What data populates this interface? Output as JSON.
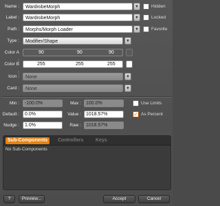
{
  "name": {
    "label": "Name :",
    "value": "WardrobeMorph"
  },
  "label_row": {
    "label": "Label :",
    "value": "WardrobeMorph"
  },
  "path": {
    "label": "Path :",
    "value": "Morphs/Morph Loader"
  },
  "type": {
    "label": "Type :",
    "value": "Modifier/Shape"
  },
  "color_a": {
    "label": "Color A :",
    "r": "90",
    "g": "90",
    "b": "90",
    "swatch": "#5a5a5a"
  },
  "color_b": {
    "label": "Color B :",
    "r": "255",
    "g": "255",
    "b": "255",
    "swatch": "#ffffff"
  },
  "icon": {
    "label": "Icon :",
    "value": "None"
  },
  "card": {
    "label": "Card :",
    "value": "None"
  },
  "checks": {
    "hidden": {
      "label": "Hidden",
      "checked": false
    },
    "locked": {
      "label": "Locked",
      "checked": false
    },
    "favorite": {
      "label": "Favorite",
      "checked": false
    },
    "use_limits": {
      "label": "Use Limits",
      "checked": false
    },
    "as_percent": {
      "label": "As Percent",
      "checked": true
    }
  },
  "limits": {
    "min_label": "Min :",
    "min_value": "-100.0%",
    "max_label": "Max :",
    "max_value": "100.0%",
    "default_label": "Default :",
    "default_value": "0.0%",
    "value_label": "Value :",
    "value_value": "1018.57%",
    "nudge_label": "Nudge :",
    "nudge_value": "1.0%",
    "raw_label": "Raw :",
    "raw_value": "1018.57%"
  },
  "tabs": [
    "Sub-Components",
    "Controllers",
    "Keys"
  ],
  "panel_text": "No Sub-Components",
  "buttons": {
    "help": "?",
    "preview": "Preview...",
    "accept": "Accept",
    "cancel": "Cancel"
  },
  "icons": {
    "dropdown": "chevron-down-icon",
    "check": "checkmark-icon"
  }
}
